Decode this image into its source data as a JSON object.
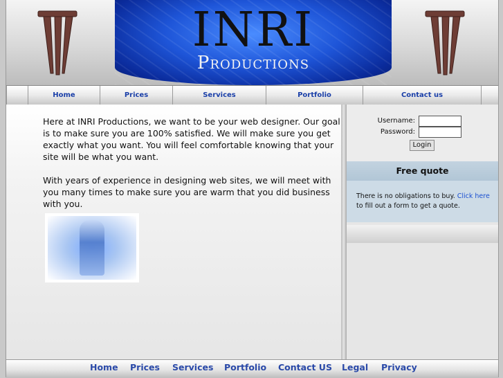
{
  "header": {
    "title": "INRI",
    "subtitle": "Productions"
  },
  "topnav": [
    "Home",
    "Prices",
    "Services",
    "Portfolio",
    "Contact us"
  ],
  "main": {
    "paragraphs": [
      "Here at INRI Productions, we want to be your web designer. Our goal is to make sure you are 100% satisfied. We will make sure you get exactly what you want. You will feel comfortable knowing that your site will be what you want.",
      "With years of experience in designing web sites, we will meet with you many times to make sure you are warm that you did business with you."
    ]
  },
  "login": {
    "username_label": "Username:",
    "password_label": "Password:",
    "username_value": "",
    "password_value": "",
    "button": "Login"
  },
  "quote": {
    "heading": "Free quote",
    "text_before": "There is no obligations to buy. ",
    "link": "Click here",
    "text_after": " to fill out a form to get a quote."
  },
  "bottomnav": [
    "Home",
    "Prices",
    "Services",
    "Portfolio",
    "Contact US",
    "Legal",
    "Privacy"
  ],
  "colors": {
    "nav_link": "#1a3fa8",
    "banner_blue": "#1e55d8",
    "quote_bg": "#cddbe6"
  }
}
